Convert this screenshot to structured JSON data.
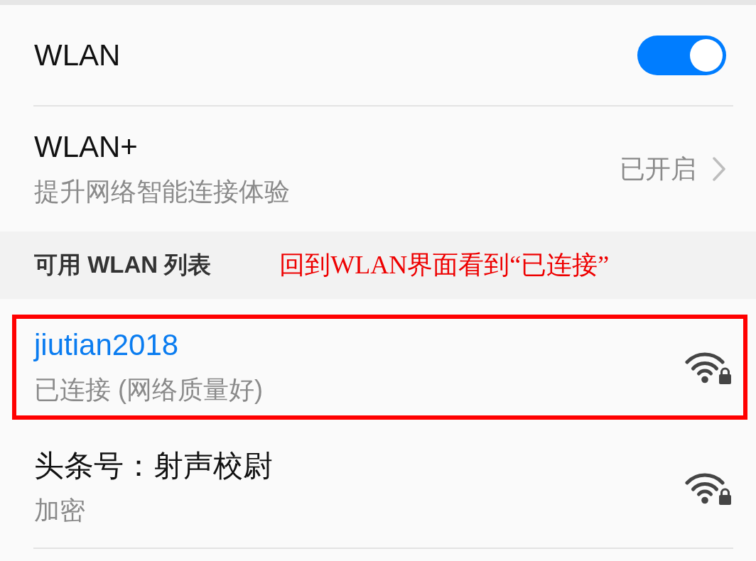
{
  "wlan": {
    "label": "WLAN",
    "on": true
  },
  "wlan_plus": {
    "title": "WLAN+",
    "subtitle": "提升网络智能连接体验",
    "status": "已开启"
  },
  "available_section": {
    "title": "可用 WLAN 列表",
    "annotation": "回到WLAN界面看到“已连接”"
  },
  "networks": [
    {
      "name": "jiutian2018",
      "status": "已连接 (网络质量好)",
      "connected": true,
      "highlighted": true,
      "locked": true
    },
    {
      "name": "头条号：射声校尉",
      "status": "加密",
      "connected": false,
      "highlighted": false,
      "locked": true
    }
  ]
}
